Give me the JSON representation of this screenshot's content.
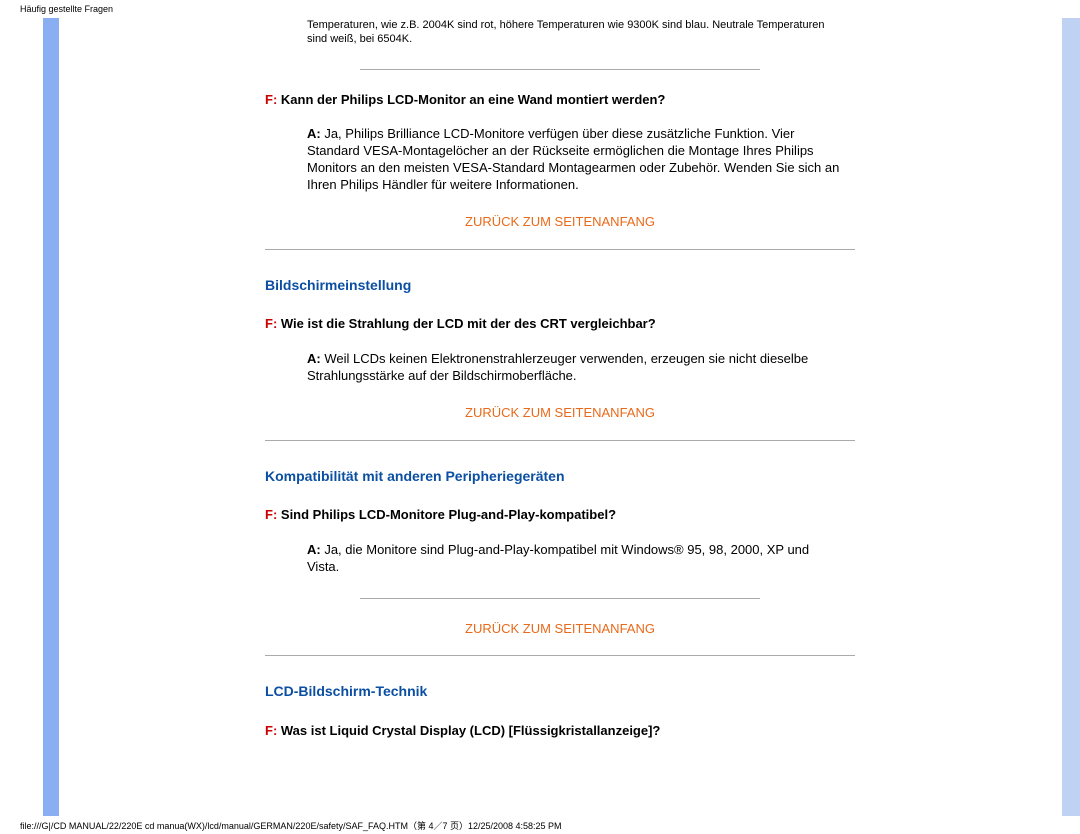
{
  "header": "Häufig gestellte Fragen",
  "intro": "Temperaturen, wie z.B. 2004K sind rot, höhere Temperaturen wie 9300K sind blau. Neutrale Temperaturen sind weiß, bei 6504K.",
  "q1": {
    "prefix": "F:",
    "text": " Kann der Philips LCD-Monitor an eine Wand montiert werden?"
  },
  "a1": {
    "prefix": "A:",
    "text": " Ja, Philips Brilliance LCD-Monitore verfügen über diese zusätzliche Funktion. Vier Standard VESA-Montagelöcher an der Rückseite ermöglichen die Montage Ihres Philips Monitors an den meisten VESA-Standard Montagearmen oder Zubehör. Wenden Sie sich an Ihren Philips Händler für weitere Informationen."
  },
  "back_link": "ZURÜCK ZUM SEITENANFANG",
  "section2": "Bildschirmeinstellung",
  "q2": {
    "prefix": "F:",
    "text": " Wie ist die Strahlung der LCD mit der des CRT vergleichbar?"
  },
  "a2": {
    "prefix": "A:",
    "text": " Weil LCDs keinen Elektronenstrahlerzeuger verwenden, erzeugen sie nicht dieselbe Strahlungsstärke auf der Bildschirmoberfläche."
  },
  "section3": "Kompatibilität mit anderen Peripheriegeräten",
  "q3": {
    "prefix": "F:",
    "text": " Sind Philips LCD-Monitore Plug-and-Play-kompatibel?"
  },
  "a3": {
    "prefix": "A:",
    "text": " Ja, die Monitore sind Plug-and-Play-kompatibel mit Windows® 95, 98, 2000, XP und Vista."
  },
  "section4": "LCD-Bildschirm-Technik",
  "q4": {
    "prefix": "F:",
    "text": " Was ist Liquid Crystal Display (LCD) [Flüssigkristallanzeige]?"
  },
  "footer": "file:///G|/CD MANUAL/22/220E cd manua(WX)/lcd/manual/GERMAN/220E/safety/SAF_FAQ.HTM（第 4／7 页）12/25/2008 4:58:25 PM"
}
